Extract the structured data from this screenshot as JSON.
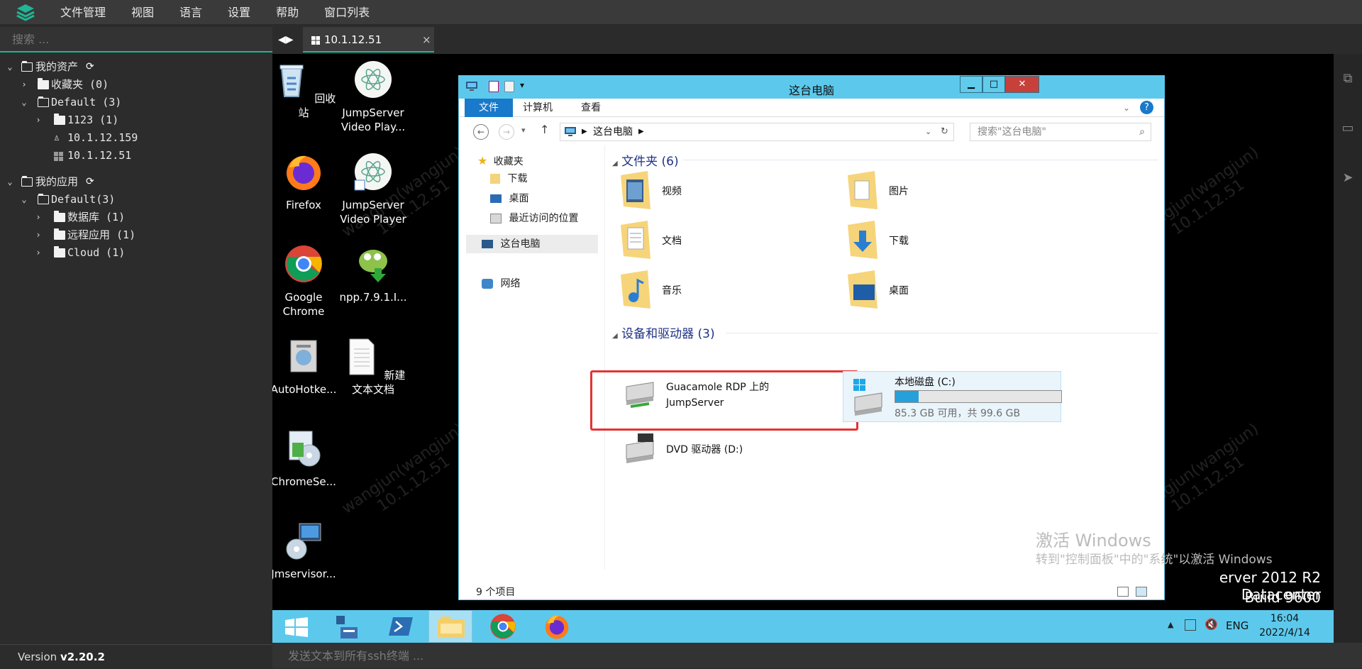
{
  "menu": {
    "items": [
      "文件管理",
      "视图",
      "语言",
      "设置",
      "帮助",
      "窗口列表"
    ]
  },
  "left": {
    "search_placeholder": "搜索 ...",
    "tree": {
      "assets": "我的资产",
      "favorites": "收藏夹 (0)",
      "default_assets": "Default (3)",
      "folder_1123": "1123 (1)",
      "host_linux": "10.1.12.159",
      "host_windows": "10.1.12.51",
      "apps": "我的应用",
      "default_apps": "Default(3)",
      "database": "数据库 (1)",
      "remote_app": "远程应用 (1)",
      "cloud": "Cloud (1)"
    },
    "version_label": "Version",
    "version_value": "v2.20.2"
  },
  "tab": {
    "label": "10.1.12.51",
    "close": "×"
  },
  "desktop": {
    "icons": {
      "recycle": "回收站",
      "jsvideo1": "JumpServer Video Play...",
      "firefox": "Firefox",
      "jsvideo2": "JumpServer Video Player",
      "chrome": "Google Chrome",
      "npp": "npp.7.9.1.I...",
      "autohotkey": "AutoHotke...",
      "newtxt": "新建文本文档",
      "chromese": "ChromeSe...",
      "jmservisor": "Jmservisor..."
    },
    "watermark_line1": "wangjun(wangjun)",
    "watermark_line2": "10.1.12.51",
    "activate_title": "激活 Windows",
    "activate_sub": "转到\"控制面板\"中的\"系统\"以激活 Windows",
    "server_line": "erver 2012 R2 Datacenter",
    "build_line": "Build 9600"
  },
  "explorer": {
    "title": "这台电脑",
    "ribbon": {
      "file": "文件",
      "computer": "计算机",
      "view": "查看"
    },
    "address": "这台电脑",
    "search_placeholder": "搜索\"这台电脑\"",
    "nav": {
      "favorites": "收藏夹",
      "downloads": "下载",
      "desktop": "桌面",
      "recent": "最近访问的位置",
      "thispc": "这台电脑",
      "network": "网络"
    },
    "folders_header": "文件夹 (6)",
    "folders": {
      "videos": "视频",
      "pictures": "图片",
      "documents": "文档",
      "downloads": "下载",
      "music": "音乐",
      "desktop": "桌面"
    },
    "devices_header": "设备和驱动器 (3)",
    "devices": {
      "guac_line1": "Guacamole RDP 上的",
      "guac_line2": "JumpServer",
      "local_disk": "本地磁盘 (C:)",
      "local_free": "85.3 GB 可用，共 99.6 GB",
      "local_used_fraction": 0.14,
      "dvd": "DVD 驱动器 (D:)"
    },
    "status": "9 个项目"
  },
  "taskbar": {
    "lang": "ENG",
    "time": "16:04",
    "date": "2022/4/14"
  },
  "send_placeholder": "发送文本到所有ssh终端 ..."
}
